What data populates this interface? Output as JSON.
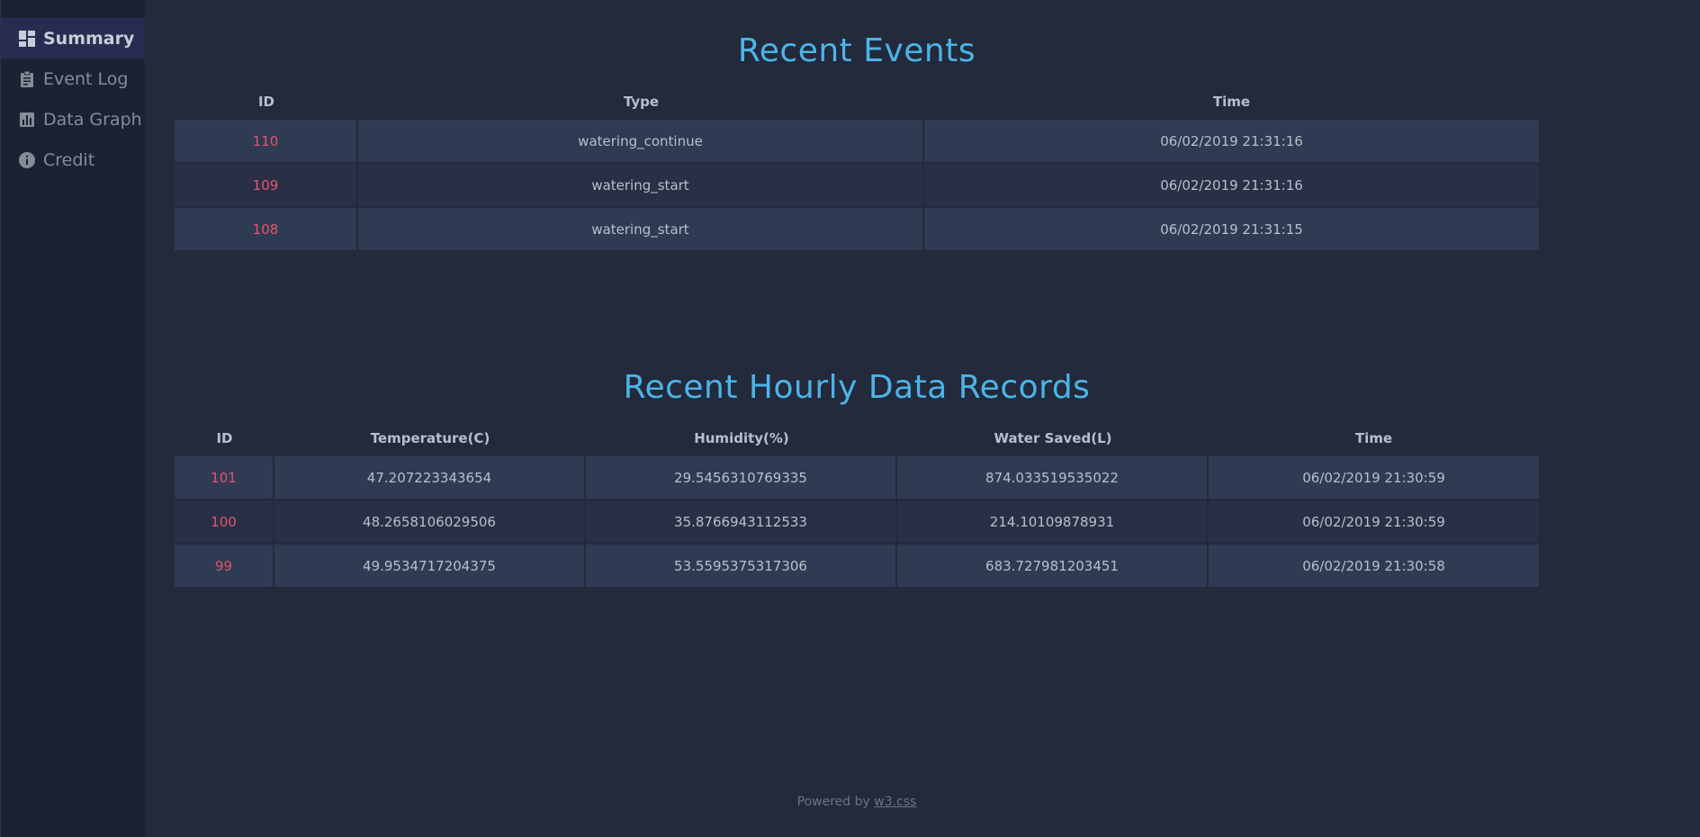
{
  "sidebar": {
    "items": [
      {
        "label": "Summary",
        "icon": "dashboard-icon",
        "active": true
      },
      {
        "label": "Event Log",
        "icon": "clipboard-icon",
        "active": false
      },
      {
        "label": "Data Graph",
        "icon": "bar-chart-icon",
        "active": false
      },
      {
        "label": "Credit",
        "icon": "info-icon",
        "active": false
      }
    ]
  },
  "events": {
    "title": "Recent Events",
    "headers": [
      "ID",
      "Type",
      "Time"
    ],
    "rows": [
      [
        "110",
        "watering_continue",
        "06/02/2019 21:31:16"
      ],
      [
        "109",
        "watering_start",
        "06/02/2019 21:31:16"
      ],
      [
        "108",
        "watering_start",
        "06/02/2019 21:31:15"
      ]
    ]
  },
  "records": {
    "title": "Recent Hourly Data Records",
    "headers": [
      "ID",
      "Temperature(C)",
      "Humidity(%)",
      "Water Saved(L)",
      "Time"
    ],
    "rows": [
      [
        "101",
        "47.207223343654",
        "29.5456310769335",
        "874.033519535022",
        "06/02/2019 21:30:59"
      ],
      [
        "100",
        "48.2658106029506",
        "35.8766943112533",
        "214.10109878931",
        "06/02/2019 21:30:59"
      ],
      [
        "99",
        "49.9534717204375",
        "53.5595375317306",
        "683.727981203451",
        "06/02/2019 21:30:58"
      ]
    ]
  },
  "footer": {
    "prefix": "Powered by ",
    "link": "w3.css"
  },
  "colors": {
    "accent": "#4db3e6",
    "id_text": "#e0566e",
    "background": "#222a3c",
    "sidebar": "#1c2233",
    "active_item": "#282c50"
  }
}
